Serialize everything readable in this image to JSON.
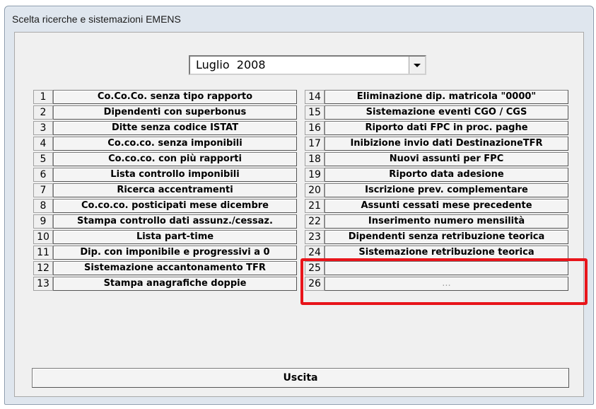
{
  "window": {
    "title": "Scelta ricerche e sistemazioni EMENS"
  },
  "period": {
    "month": "Luglio",
    "year": "2008"
  },
  "left_items": [
    {
      "num": "1",
      "label": "Co.Co.Co. senza tipo rapporto"
    },
    {
      "num": "2",
      "label": "Dipendenti con superbonus"
    },
    {
      "num": "3",
      "label": "Ditte senza codice ISTAT"
    },
    {
      "num": "4",
      "label": "Co.co.co. senza imponibili"
    },
    {
      "num": "5",
      "label": "Co.co.co. con più rapporti"
    },
    {
      "num": "6",
      "label": "Lista controllo imponibili"
    },
    {
      "num": "7",
      "label": "Ricerca accentramenti"
    },
    {
      "num": "8",
      "label": "Co.co.co. posticipati mese dicembre"
    },
    {
      "num": "9",
      "label": "Stampa controllo dati assunz./cessaz."
    },
    {
      "num": "10",
      "label": "Lista part-time"
    },
    {
      "num": "11",
      "label": "Dip. con imponibile e progressivi a 0"
    },
    {
      "num": "12",
      "label": "Sistemazione  accantonamento TFR"
    },
    {
      "num": "13",
      "label": "Stampa anagrafiche doppie"
    }
  ],
  "right_items": [
    {
      "num": "14",
      "label": "Eliminazione dip. matricola \"0000\""
    },
    {
      "num": "15",
      "label": "Sistemazione eventi CGO / CGS"
    },
    {
      "num": "16",
      "label": "Riporto dati FPC in proc. paghe"
    },
    {
      "num": "17",
      "label": "Inibizione invio dati DestinazioneTFR"
    },
    {
      "num": "18",
      "label": "Nuovi assunti per FPC"
    },
    {
      "num": "19",
      "label": "Riporto data adesione"
    },
    {
      "num": "20",
      "label": "Iscrizione prev. complementare"
    },
    {
      "num": "21",
      "label": "Assunti cessati mese precedente"
    },
    {
      "num": "22",
      "label": "Inserimento numero mensilità"
    },
    {
      "num": "23",
      "label": "Dipendenti senza retribuzione teorica"
    },
    {
      "num": "24",
      "label": "Sistemazione retribuzione teorica"
    },
    {
      "num": "25",
      "label": ""
    },
    {
      "num": "26",
      "label": "..."
    }
  ],
  "exit_label": "Uscita",
  "highlight_color": "#e8141a"
}
